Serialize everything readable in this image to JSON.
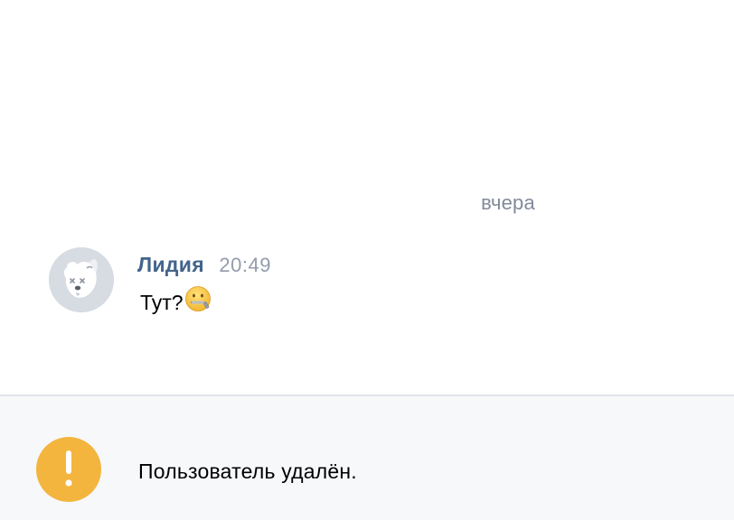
{
  "chat": {
    "date_divider": "вчера",
    "messages": [
      {
        "author": "Лидия",
        "time": "20:49",
        "text": "Тут?",
        "emoji": "zipper-mouth-face",
        "avatar": "deactivated-dog-avatar"
      }
    ]
  },
  "notice": {
    "text": "Пользователь удалён.",
    "icon": "exclamation-icon",
    "icon_color": "#f3b53d"
  },
  "colors": {
    "author": "#42648b",
    "meta": "#939cab",
    "notice_bg": "#f7f8fa"
  }
}
